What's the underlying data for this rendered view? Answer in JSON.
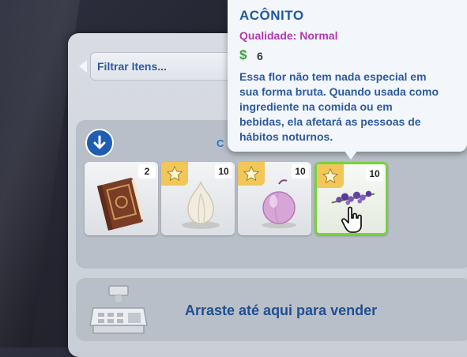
{
  "filter": {
    "label": "Filtrar Itens..."
  },
  "inventory": {
    "category_label": "C",
    "slots": [
      {
        "name": "book",
        "count": "2",
        "starred": false
      },
      {
        "name": "garlic",
        "count": "10",
        "starred": true
      },
      {
        "name": "onion",
        "count": "10",
        "starred": true
      },
      {
        "name": "aconite",
        "count": "10",
        "starred": true,
        "selected": true
      }
    ]
  },
  "sell": {
    "label": "Arraste até aqui para vender"
  },
  "tooltip": {
    "title": "ACÔNITO",
    "quality": "Qualidade: Normal",
    "price_symbol": "$",
    "price": "6",
    "description": "Essa flor não tem nada especial em\nsua forma bruta. Quando usada como\ningrediente na comida ou em\nbebidas, ela afetará as pessoas de\nhábitos noturnos."
  },
  "colors": {
    "accent": "#2d5aa0",
    "quality": "#b339b0",
    "price": "#3aa33a",
    "selection": "#7ad03f",
    "star": "#f1c75a"
  }
}
